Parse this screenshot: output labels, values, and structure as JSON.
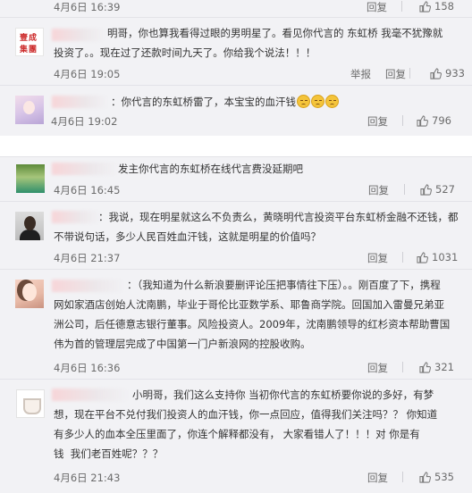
{
  "colors": {
    "panel": "#f2f2f5",
    "text": "#333333",
    "meta": "#6b6b6b",
    "link": "#eb7350"
  },
  "icons": {
    "like": "thumbs-up-icon"
  },
  "top_panel": {
    "entries": [
      {
        "time": "4月6日 16:39",
        "reply": "回复",
        "likes": "158"
      },
      {
        "avatar_text": "壹成集团",
        "text": "明哥，你也算我看得过眼的男明星了。看见你代言的 东虹桥 我毫不犹豫就\n投资了。。现在过了还款时间九天了。你给我个说法！！！",
        "time": "4月6日 19:05",
        "report": "举报",
        "reply": "回复",
        "likes": "933"
      },
      {
        "text": "：你代言的东虹桥雷了，本宝宝的血汗钱",
        "time": "4月6日 19:02",
        "reply": "回复",
        "likes": "796"
      }
    ]
  },
  "bottom_panel": {
    "entries": [
      {
        "text": "发主你代言的东虹桥在线代言费没延期吧",
        "time": "4月6日 16:45",
        "reply": "回复",
        "likes": "527"
      },
      {
        "text": "：我说，现在明星就这么不负责么，黄晓明代言投资平台东虹桥金融不还钱，都\n不带说句话，多少人民百姓血汗钱，这就是明星的价值吗？",
        "time": "4月6日 21:37",
        "reply": "回复",
        "likes": "1031"
      },
      {
        "text": "：（我知道为什么新浪要删评论压把事情往下压）。。刚百度了下，携程\n网如家酒店创始人沈南鹏，毕业于哥伦比亚数学系、耶鲁商学院。回国加入雷曼兄弟亚\n洲公司，后任德意志银行董事。风险投资人。2009年，沈南鹏领导的红杉资本帮助曹国\n伟为首的管理层完成了中国第一门户新浪网的控股收购。",
        "time": "4月6日 16:36",
        "reply": "回复",
        "likes": "321"
      },
      {
        "text": "小明哥，我们这么支持你 当初你代言的东虹桥要你说的多好，有梦\n想，现在平台不兑付我们投资人的血汗钱，你一点回应，值得我们关注吗？？ 你知道\n有多少人的血本全压里面了，你连个解释都没有， 大家看错人了！！！对 你是有\n钱  我们老百姓呢？？？",
        "time": "4月6日 21:43",
        "reply": "回复",
        "likes": "535"
      }
    ]
  }
}
